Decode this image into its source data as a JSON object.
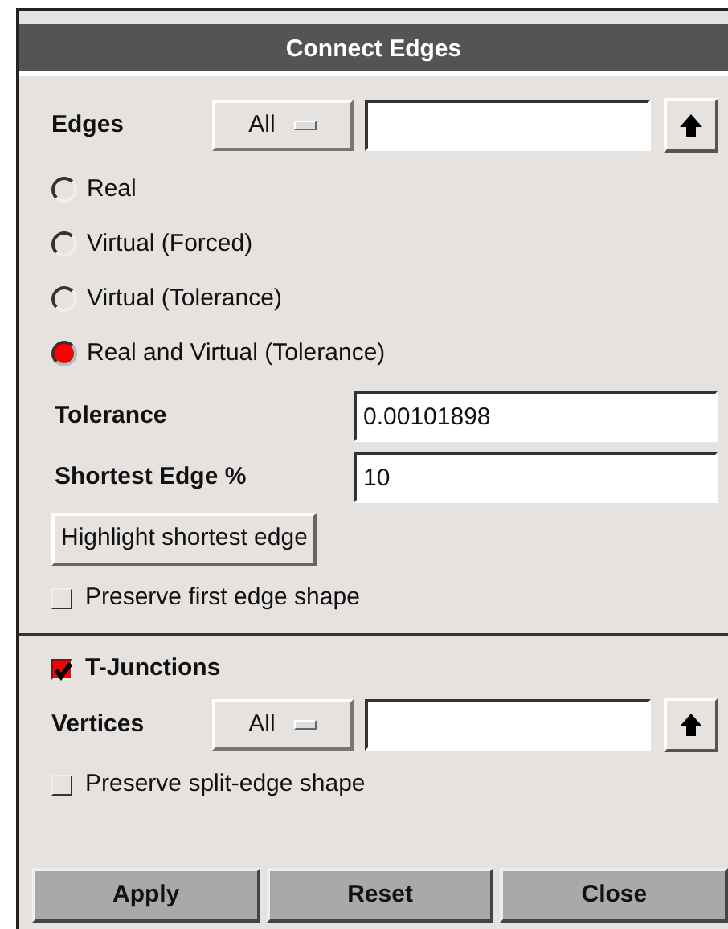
{
  "window": {
    "title": "Connect Edges"
  },
  "edges": {
    "label": "Edges",
    "dropdown": "All"
  },
  "modes": [
    {
      "label": "Real",
      "selected": false
    },
    {
      "label": "Virtual (Forced)",
      "selected": false
    },
    {
      "label": "Virtual (Tolerance)",
      "selected": false
    },
    {
      "label": "Real and Virtual (Tolerance)",
      "selected": true
    }
  ],
  "fields": [
    {
      "label": "Tolerance",
      "value": "0.00101898"
    },
    {
      "label": "Shortest Edge %",
      "value": "10"
    }
  ],
  "highlight_button": "Highlight shortest edge",
  "preserve_first": {
    "label": "Preserve first edge shape",
    "checked": false
  },
  "t_junctions": {
    "label": "T-Junctions",
    "checked": true
  },
  "vertices": {
    "label": "Vertices",
    "dropdown": "All"
  },
  "preserve_split": {
    "label": "Preserve split-edge shape",
    "checked": false
  },
  "buttons": [
    "Apply",
    "Reset",
    "Close"
  ]
}
